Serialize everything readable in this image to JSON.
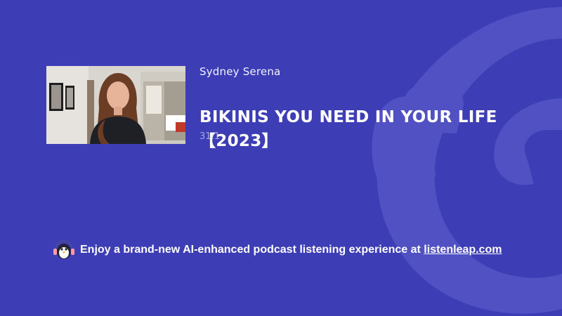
{
  "episode": {
    "author": "Sydney Serena",
    "title": "BIKINIS YOU NEED IN YOUR LIFE 【2023】",
    "meta": "31:1"
  },
  "footer": {
    "promo_text": "Enjoy a brand-new AI-enhanced podcast listening experience at ",
    "link_text": "listenleap.com"
  },
  "icons": {
    "mascot": "penguin-headphones-icon",
    "background": "headphones-logo-icon"
  },
  "colors": {
    "background": "#3d3db5",
    "logo_watermark": "#5050c2"
  }
}
